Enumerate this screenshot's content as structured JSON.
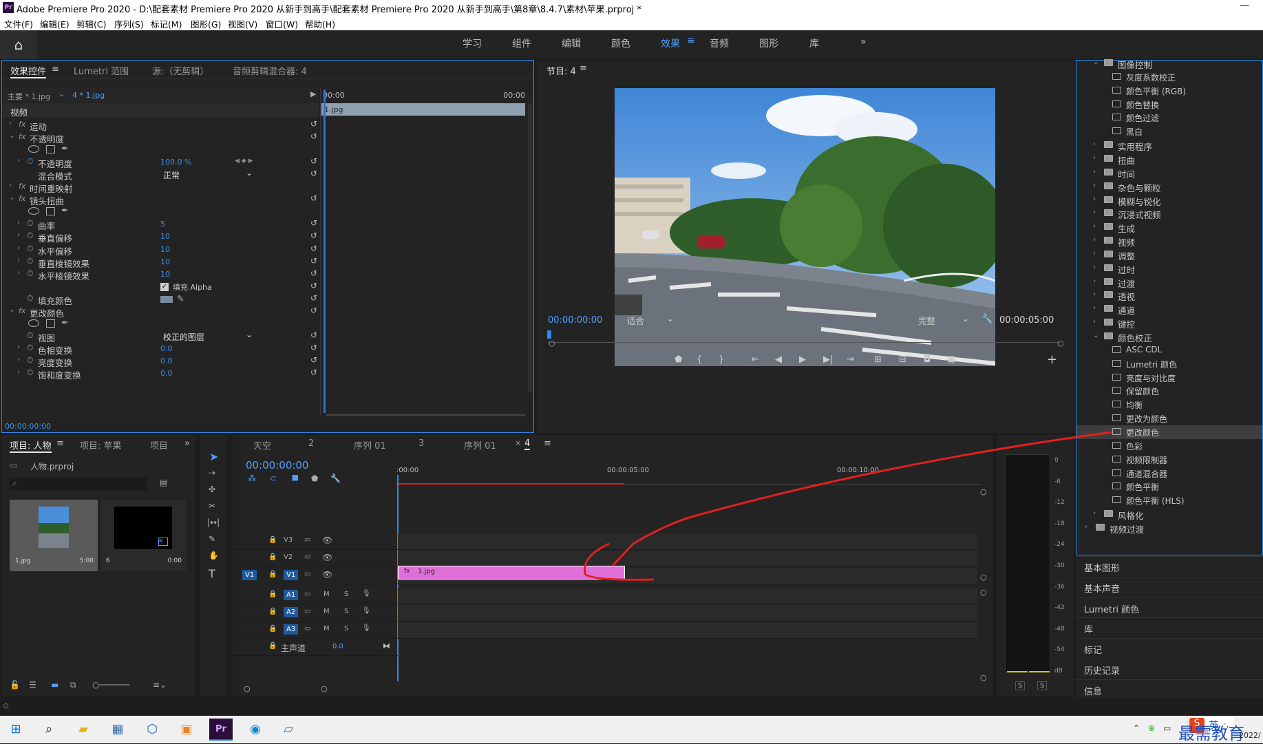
{
  "window": {
    "title": "Adobe Premiere Pro 2020 - D:\\配套素材 Premiere Pro 2020 从新手到高手\\配套素材 Premiere Pro 2020 从新手到高手\\第8章\\8.4.7\\素材\\苹果.prproj *",
    "app_icon": "Pr",
    "minimize": "—"
  },
  "menu": [
    "文件(F)",
    "编辑(E)",
    "剪辑(C)",
    "序列(S)",
    "标记(M)",
    "图形(G)",
    "视图(V)",
    "窗口(W)",
    "帮助(H)"
  ],
  "workspaces": [
    "学习",
    "组件",
    "编辑",
    "颜色",
    "效果",
    "音频",
    "图形",
    "库"
  ],
  "workspace_active": "效果",
  "workspace_more": "»",
  "effect_controls": {
    "tabs": [
      "效果控件",
      "Lumetri 范围",
      "源:（无剪辑）",
      "音频剪辑混合器: 4"
    ],
    "master": "主要 * 1.jpg",
    "clip": "4 * 1.jpg",
    "time_start": "00:00",
    "time_end": "00:00",
    "clip_bar": "1.jpg",
    "section_video": "视频",
    "rows": [
      {
        "label": "运动",
        "type": "fx"
      },
      {
        "label": "不透明度",
        "type": "fx-open"
      },
      {
        "label": "",
        "type": "shapes"
      },
      {
        "label": "不透明度",
        "type": "prop",
        "value": "100.0 %",
        "keyframe": true
      },
      {
        "label": "混合模式",
        "type": "select",
        "value": "正常"
      },
      {
        "label": "时间重映射",
        "type": "fx"
      },
      {
        "label": "镜头扭曲",
        "type": "fx-open"
      },
      {
        "label": "",
        "type": "shapes"
      },
      {
        "label": "曲率",
        "type": "prop",
        "value": "5"
      },
      {
        "label": "垂直偏移",
        "type": "prop",
        "value": "10"
      },
      {
        "label": "水平偏移",
        "type": "prop",
        "value": "10"
      },
      {
        "label": "垂直棱镜效果",
        "type": "prop",
        "value": "10"
      },
      {
        "label": "水平棱镜效果",
        "type": "prop",
        "value": "10"
      },
      {
        "label": "填充 Alpha",
        "type": "check"
      },
      {
        "label": "填充颜色",
        "type": "color"
      },
      {
        "label": "更改颜色",
        "type": "fx-open"
      },
      {
        "label": "",
        "type": "shapes"
      },
      {
        "label": "视图",
        "type": "select",
        "value": "校正的图层"
      },
      {
        "label": "色相变换",
        "type": "prop",
        "value": "0.0"
      },
      {
        "label": "亮度变换",
        "type": "prop",
        "value": "0.0"
      },
      {
        "label": "饱和度变换",
        "type": "prop",
        "value": "0.0"
      }
    ],
    "timecode": "00:00:00:00"
  },
  "program": {
    "title": "节目: 4",
    "timecode": "00:00:00:00",
    "fit": "适合",
    "quality": "完整",
    "duration": "00:00:05:00",
    "add": "+"
  },
  "effects_tree": [
    {
      "label": "图像控制",
      "level": 1,
      "kind": "folder",
      "open": true
    },
    {
      "label": "灰度系数校正",
      "level": 2,
      "kind": "fx"
    },
    {
      "label": "颜色平衡 (RGB)",
      "level": 2,
      "kind": "fx"
    },
    {
      "label": "颜色替换",
      "level": 2,
      "kind": "fx"
    },
    {
      "label": "颜色过滤",
      "level": 2,
      "kind": "fx"
    },
    {
      "label": "黑白",
      "level": 2,
      "kind": "fx"
    },
    {
      "label": "实用程序",
      "level": 1,
      "kind": "folder"
    },
    {
      "label": "扭曲",
      "level": 1,
      "kind": "folder"
    },
    {
      "label": "时间",
      "level": 1,
      "kind": "folder"
    },
    {
      "label": "杂色与颗粒",
      "level": 1,
      "kind": "folder"
    },
    {
      "label": "模糊与锐化",
      "level": 1,
      "kind": "folder"
    },
    {
      "label": "沉浸式视频",
      "level": 1,
      "kind": "folder"
    },
    {
      "label": "生成",
      "level": 1,
      "kind": "folder"
    },
    {
      "label": "视频",
      "level": 1,
      "kind": "folder"
    },
    {
      "label": "调整",
      "level": 1,
      "kind": "folder"
    },
    {
      "label": "过时",
      "level": 1,
      "kind": "folder"
    },
    {
      "label": "过渡",
      "level": 1,
      "kind": "folder"
    },
    {
      "label": "透视",
      "level": 1,
      "kind": "folder"
    },
    {
      "label": "通道",
      "level": 1,
      "kind": "folder"
    },
    {
      "label": "键控",
      "level": 1,
      "kind": "folder"
    },
    {
      "label": "颜色校正",
      "level": 1,
      "kind": "folder",
      "open": true
    },
    {
      "label": "ASC CDL",
      "level": 2,
      "kind": "fx"
    },
    {
      "label": "Lumetri 颜色",
      "level": 2,
      "kind": "fx"
    },
    {
      "label": "亮度与对比度",
      "level": 2,
      "kind": "fx"
    },
    {
      "label": "保留颜色",
      "level": 2,
      "kind": "fx"
    },
    {
      "label": "均衡",
      "level": 2,
      "kind": "fx"
    },
    {
      "label": "更改为颜色",
      "level": 2,
      "kind": "fx"
    },
    {
      "label": "更改颜色",
      "level": 2,
      "kind": "fx",
      "selected": true
    },
    {
      "label": "色彩",
      "level": 2,
      "kind": "fx"
    },
    {
      "label": "视频限制器",
      "level": 2,
      "kind": "fx"
    },
    {
      "label": "通道混合器",
      "level": 2,
      "kind": "fx"
    },
    {
      "label": "颜色平衡",
      "level": 2,
      "kind": "fx"
    },
    {
      "label": "颜色平衡 (HLS)",
      "level": 2,
      "kind": "fx"
    },
    {
      "label": "风格化",
      "level": 1,
      "kind": "folder"
    },
    {
      "label": "视频过渡",
      "level": 0,
      "kind": "folder"
    }
  ],
  "side_panels": [
    "基本图形",
    "基本声音",
    "Lumetri 颜色",
    "库",
    "标记",
    "历史记录",
    "信息"
  ],
  "project": {
    "tabs": [
      "项目: 人物",
      "项目: 苹果",
      "项目"
    ],
    "file": "人物.prproj",
    "items": [
      {
        "name": "1.jpg",
        "duration": "5:00"
      },
      {
        "name": "6",
        "duration": "0:00"
      }
    ]
  },
  "timeline": {
    "tabs": [
      "天空",
      "2",
      "序列 01",
      "3",
      "序列 01",
      "4"
    ],
    "active_tab": "4",
    "timecode": "00:00:00:00",
    "ruler": [
      ":00:00",
      "00:00:05:00",
      "00:00:10:00"
    ],
    "video_tracks": [
      "V3",
      "V2",
      "V1"
    ],
    "audio_tracks": [
      "A1",
      "A2",
      "A3"
    ],
    "source_v": "V1",
    "master": "主声道",
    "master_val": "0.0",
    "clip": "1.jpg"
  },
  "meter": {
    "scale": [
      "0",
      "-6",
      "-12",
      "-18",
      "-24",
      "-30",
      "-36",
      "-42",
      "-48",
      "-54",
      "dB"
    ],
    "solo": [
      "S",
      "S"
    ]
  },
  "taskbar": {
    "ime": "英",
    "ime_extra": "·,",
    "watermark": "最需教育",
    "year": "2022/"
  },
  "colors": {
    "accent": "#2c8ae8",
    "clip": "#e070d8",
    "annotation": "#e02020",
    "active_tab": "#4ea0ff"
  }
}
